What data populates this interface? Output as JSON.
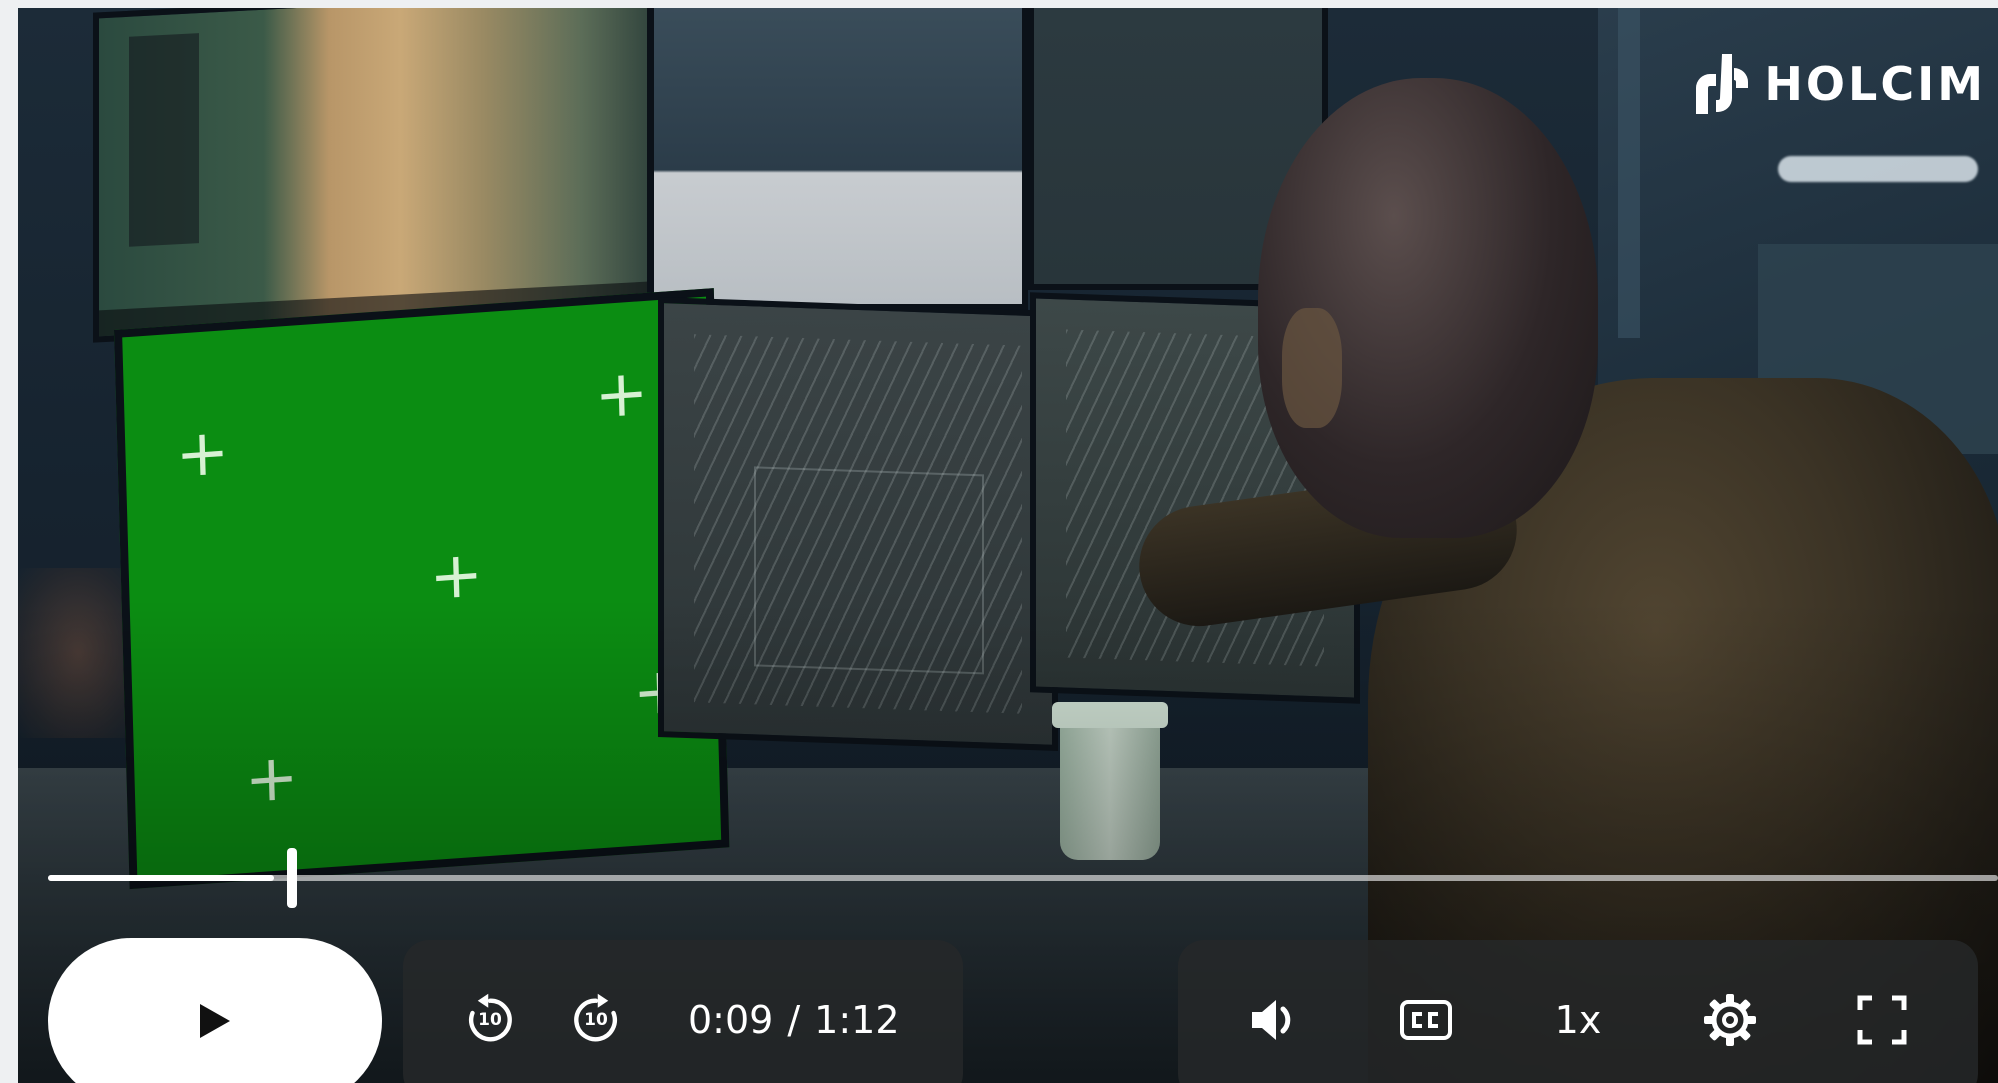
{
  "brand": {
    "name": "HOLCIM",
    "icon": "holcim-logo-icon"
  },
  "video": {
    "current_time": "0:09",
    "separator": "/",
    "duration": "1:12",
    "progress_fraction": 0.125
  },
  "controls": {
    "play_icon": "play-icon",
    "rewind_icon": "rewind-10-icon",
    "rewind_seconds": "10",
    "forward_icon": "forward-10-icon",
    "forward_seconds": "10",
    "volume_icon": "volume-icon",
    "captions_icon": "closed-captions-icon",
    "speed": "1x",
    "settings_icon": "gear-icon",
    "fullscreen_icon": "fullscreen-icon"
  },
  "colors": {
    "controls_bg": "#26282a",
    "accent": "#ffffff",
    "chroma_green": "#0b8d12"
  }
}
